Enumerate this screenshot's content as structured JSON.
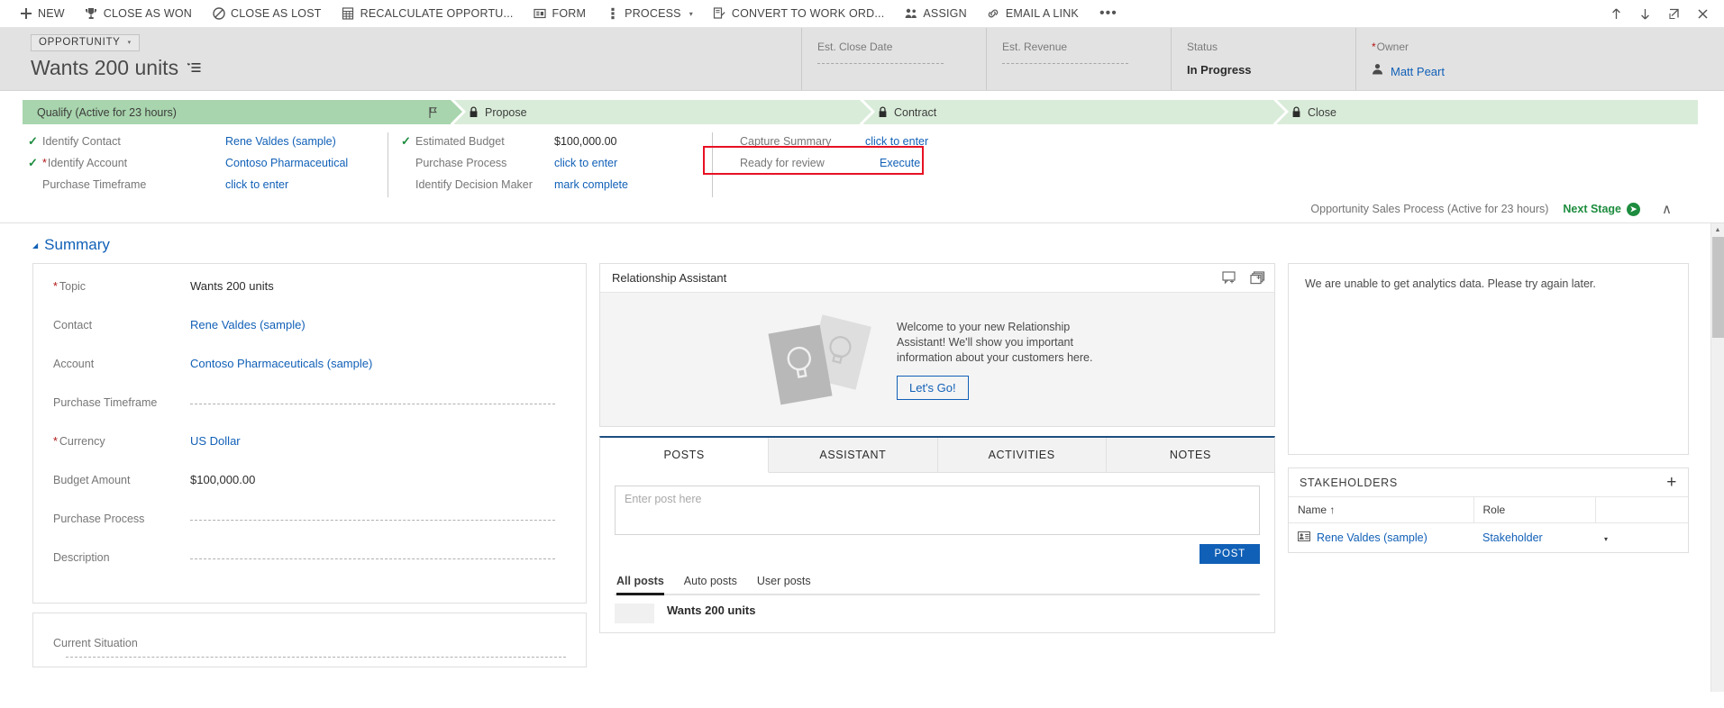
{
  "commandbar": {
    "items": [
      {
        "label": "NEW",
        "icon": "plus-icon"
      },
      {
        "label": "CLOSE AS WON",
        "icon": "trophy-icon"
      },
      {
        "label": "CLOSE AS LOST",
        "icon": "prohibit-icon"
      },
      {
        "label": "RECALCULATE OPPORTU...",
        "icon": "calculator-icon"
      },
      {
        "label": "FORM",
        "icon": "form-icon"
      },
      {
        "label": "PROCESS",
        "icon": "process-icon",
        "caret": "▾"
      },
      {
        "label": "CONVERT TO WORK ORD...",
        "icon": "convert-work-order-icon"
      },
      {
        "label": "ASSIGN",
        "icon": "assign-users-icon"
      },
      {
        "label": "EMAIL A LINK",
        "icon": "link-icon"
      }
    ],
    "overflow_label": "•••",
    "window_controls": [
      {
        "name": "up-arrow-icon",
        "glyph": "↑"
      },
      {
        "name": "down-arrow-icon",
        "glyph": "↓"
      },
      {
        "name": "popout-icon",
        "glyph": "↗"
      },
      {
        "name": "close-icon",
        "glyph": "✕"
      }
    ]
  },
  "header": {
    "entity_type": "OPPORTUNITY",
    "entity_caret": "▾",
    "record_title": "Wants 200 units",
    "fields": [
      {
        "label": "Est. Close Date",
        "value": "",
        "required": false,
        "empty": true
      },
      {
        "label": "Est. Revenue",
        "value": "",
        "required": false,
        "empty": true
      },
      {
        "label": "Status",
        "value": "In Progress",
        "required": false,
        "empty": false
      },
      {
        "label": "Owner",
        "value": "Matt Peart",
        "required": true,
        "empty": false,
        "is_link": true
      }
    ]
  },
  "process": {
    "stages": [
      {
        "label": "Qualify (Active for 23 hours)",
        "active": true,
        "locked": false
      },
      {
        "label": "Propose",
        "active": false,
        "locked": true
      },
      {
        "label": "Contract",
        "active": false,
        "locked": true
      },
      {
        "label": "Close",
        "active": false,
        "locked": true
      }
    ],
    "step_columns": [
      {
        "steps": [
          {
            "checked": true,
            "required": false,
            "label": "Identify Contact",
            "value": "Rene Valdes (sample)",
            "link": true
          },
          {
            "checked": true,
            "required": true,
            "label": "Identify Account",
            "value": "Contoso Pharmaceutical",
            "link": true
          },
          {
            "checked": false,
            "required": false,
            "label": "Purchase Timeframe",
            "value": "click to enter",
            "link": true
          }
        ]
      },
      {
        "steps": [
          {
            "checked": true,
            "required": false,
            "label": "Estimated Budget",
            "value": "$100,000.00",
            "link": false
          },
          {
            "checked": false,
            "required": false,
            "label": "Purchase Process",
            "value": "click to enter",
            "link": true
          },
          {
            "checked": false,
            "required": false,
            "label": "Identify Decision Maker",
            "value": "mark complete",
            "link": true
          }
        ]
      },
      {
        "steps": [
          {
            "checked": false,
            "required": false,
            "label": "Capture Summary",
            "value": "click to enter",
            "link": true
          },
          {
            "checked": false,
            "required": false,
            "label": "Ready for review",
            "value": "Execute",
            "link": true
          }
        ]
      }
    ],
    "footer": {
      "process_name": "Opportunity Sales Process (Active for 23 hours)",
      "next_stage_label": "Next Stage",
      "next_stage_arrow": "➜",
      "collapse_glyph": "∧"
    }
  },
  "summary": {
    "section_title": "Summary",
    "section_caret": "◢",
    "fields": [
      {
        "label": "Topic",
        "value": "Wants 200 units",
        "required": true,
        "link": false,
        "empty": false
      },
      {
        "label": "Contact",
        "value": "Rene Valdes (sample)",
        "required": false,
        "link": true,
        "empty": false
      },
      {
        "label": "Account",
        "value": "Contoso Pharmaceuticals (sample)",
        "required": false,
        "link": true,
        "empty": false
      },
      {
        "label": "Purchase Timeframe",
        "value": "",
        "required": false,
        "link": false,
        "empty": true
      },
      {
        "label": "Currency",
        "value": "US Dollar",
        "required": true,
        "link": true,
        "empty": false
      },
      {
        "label": "Budget Amount",
        "value": "$100,000.00",
        "required": false,
        "link": false,
        "empty": false
      },
      {
        "label": "Purchase Process",
        "value": "",
        "required": false,
        "link": false,
        "empty": true
      },
      {
        "label": "Description",
        "value": "",
        "required": false,
        "link": false,
        "empty": true
      }
    ],
    "current_situation_label": "Current Situation"
  },
  "relationship_assistant": {
    "title": "Relationship Assistant",
    "welcome_text": "Welcome to your new Relationship Assistant! We'll show you important information about your customers here.",
    "cta_label": "Let's Go!",
    "header_icons": [
      {
        "name": "add-card-icon"
      },
      {
        "name": "stack-cards-icon"
      }
    ]
  },
  "social_pane": {
    "tabs": [
      {
        "label": "POSTS",
        "selected": true
      },
      {
        "label": "ASSISTANT",
        "selected": false
      },
      {
        "label": "ACTIVITIES",
        "selected": false
      },
      {
        "label": "NOTES",
        "selected": false
      }
    ],
    "post_placeholder": "Enter post here",
    "post_button_label": "POST",
    "filters": [
      {
        "label": "All posts",
        "selected": true
      },
      {
        "label": "Auto posts",
        "selected": false
      },
      {
        "label": "User posts",
        "selected": false
      }
    ],
    "posts": [
      {
        "title": "Wants 200 units"
      }
    ]
  },
  "analytics": {
    "message": "We are unable to get analytics data. Please try again later."
  },
  "stakeholders": {
    "title": "STAKEHOLDERS",
    "add_glyph": "+",
    "columns": [
      {
        "label": "Name",
        "sort_glyph": "↑"
      },
      {
        "label": "Role",
        "sort_glyph": ""
      },
      {
        "label": "",
        "sort_glyph": ""
      }
    ],
    "rows": [
      {
        "name": "Rene Valdes (sample)",
        "role": "Stakeholder",
        "caret": "▾"
      }
    ]
  },
  "colors": {
    "accent_blue": "#1160b7",
    "stage_active": "#a8d5ad",
    "stage_inactive": "#d9ecd9",
    "highlight_red": "#e81123",
    "green": "#1d8c3e",
    "header_bg": "#e2e2e2"
  }
}
